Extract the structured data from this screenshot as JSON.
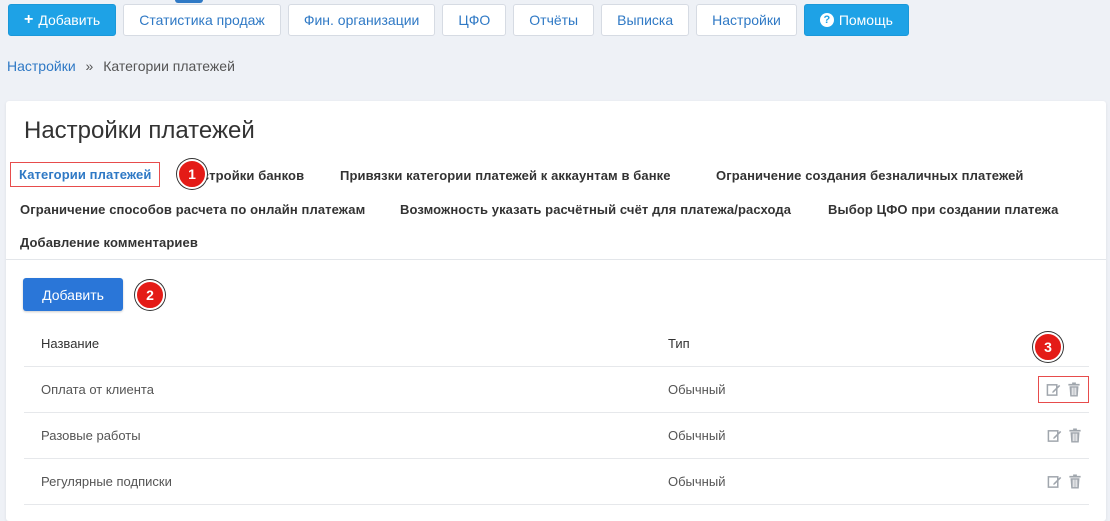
{
  "toolbar": {
    "add_label": "Добавить",
    "sales_stats_label": "Статистика продаж",
    "fin_orgs_label": "Фин. организации",
    "cfo_label": "ЦФО",
    "reports_label": "Отчёты",
    "statement_label": "Выписка",
    "settings_label": "Настройки",
    "help_label": "Помощь"
  },
  "breadcrumb": {
    "root": "Настройки",
    "separator": "»",
    "current": "Категории платежей"
  },
  "page": {
    "title": "Настройки платежей"
  },
  "tabs": [
    {
      "label": "Категории платежей"
    },
    {
      "label": "Настройки банков"
    },
    {
      "label": "Привязки категории платежей к аккаунтам в банке"
    },
    {
      "label": "Ограничение создания безналичных платежей"
    },
    {
      "label": "Ограничение способов расчета по онлайн платежам"
    },
    {
      "label": "Возможность указать расчётный счёт для платежа/расхода"
    },
    {
      "label": "Выбор ЦФО при создании платежа"
    },
    {
      "label": "Добавление комментариев"
    }
  ],
  "add_button_label": "Добавить",
  "markers": [
    "1",
    "2",
    "3"
  ],
  "table": {
    "headers": {
      "name": "Название",
      "type": "Тип"
    },
    "rows": [
      {
        "name": "Оплата от клиента",
        "type": "Обычный"
      },
      {
        "name": "Разовые работы",
        "type": "Обычный"
      },
      {
        "name": "Регулярные подписки",
        "type": "Обычный"
      }
    ]
  },
  "icons": {
    "plus": "plus-icon",
    "help": "question-circle-icon",
    "edit": "edit-icon",
    "delete": "trash-icon"
  },
  "colors": {
    "primary_blue": "#2a76d8",
    "light_blue": "#1ea2e6",
    "link_blue": "#2f79c5",
    "marker_red": "#e41b17",
    "highlight_border": "#e74c4c",
    "icon_gray": "#a0a6ad"
  }
}
